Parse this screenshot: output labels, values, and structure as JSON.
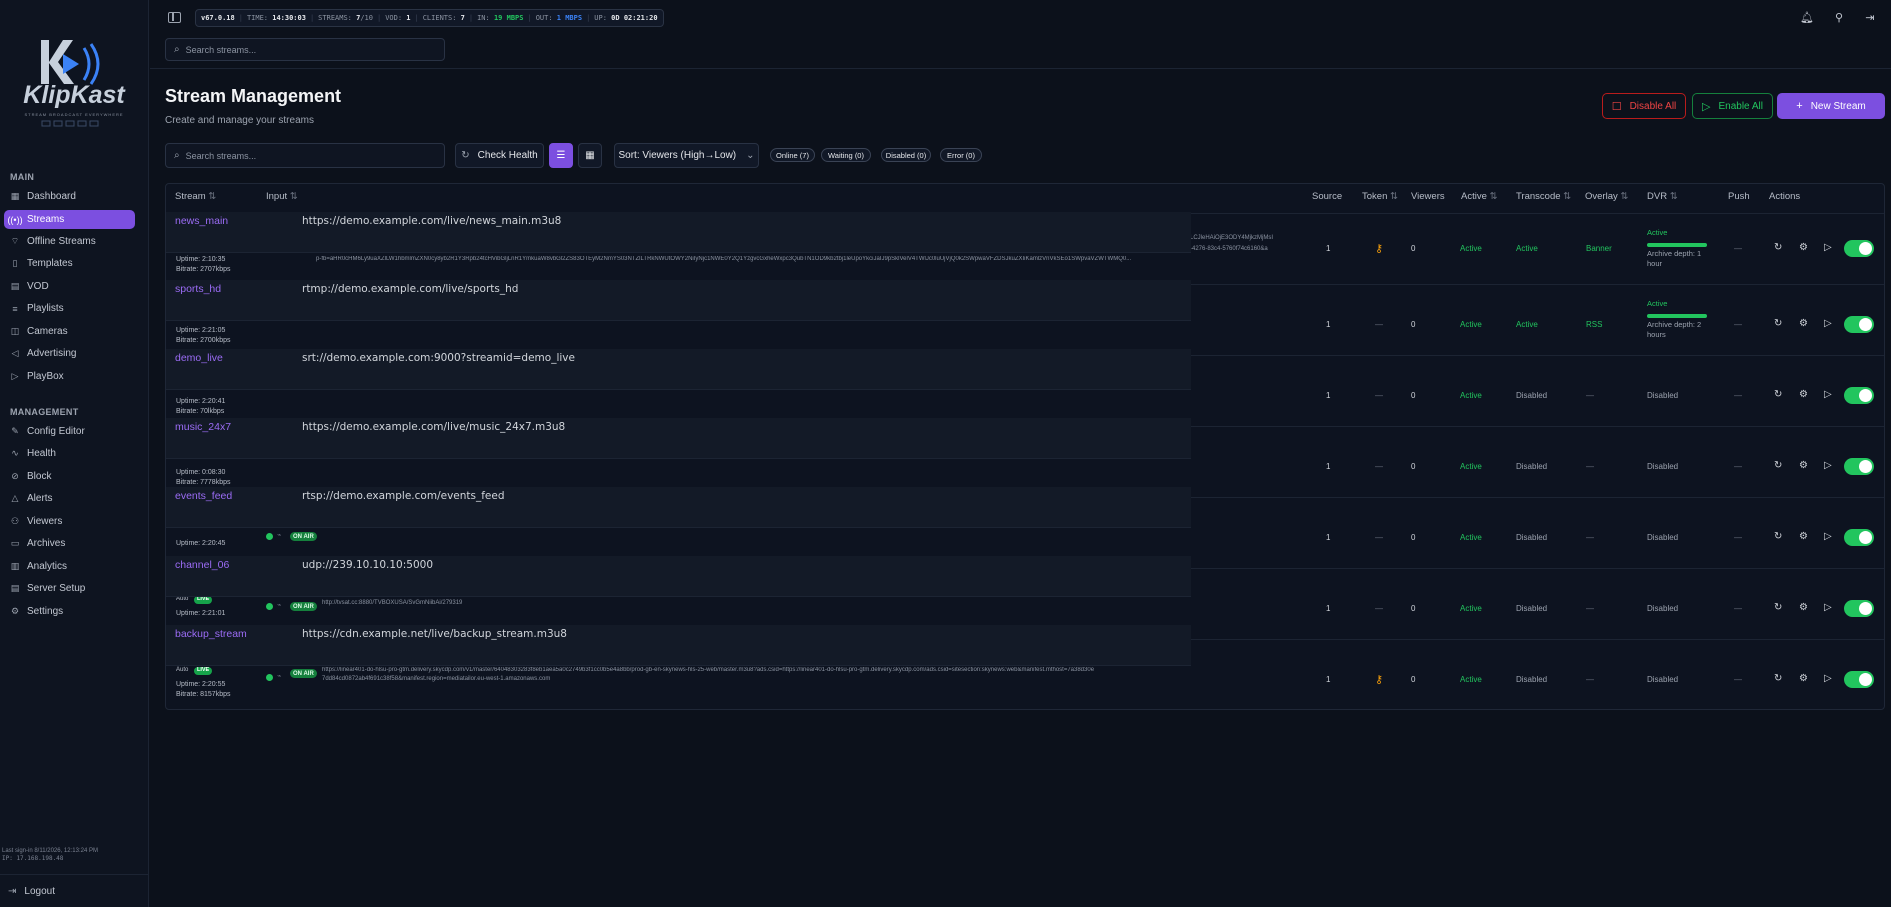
{
  "topbar": {
    "version": "v67.0.18",
    "time_label": "TIME:",
    "time": "14:30:03",
    "streams_label": "STREAMS:",
    "streams_val": "7",
    "streams_total": "/10",
    "vod_label": "VOD:",
    "vod": "1",
    "clients_label": "CLIENTS:",
    "clients": "7",
    "in_label": "IN:",
    "in_val": "19 MBPS",
    "out_label": "OUT:",
    "out_val": "1 MBPS",
    "up_label": "UP:",
    "up_val": "0D 02:21:20",
    "search_placeholder": "Search streams..."
  },
  "sidebar": {
    "brand": "KlipKast",
    "tagline": "STREAM BROADCAST EVERYWHERE",
    "main_label": "MAIN",
    "main_items": [
      {
        "label": "Dashboard",
        "icon": "grid-icon"
      },
      {
        "label": "Streams",
        "icon": "broadcast-icon"
      },
      {
        "label": "Offline Streams",
        "icon": "wifi-off-icon"
      },
      {
        "label": "Templates",
        "icon": "file-icon"
      },
      {
        "label": "VOD",
        "icon": "film-icon"
      },
      {
        "label": "Playlists",
        "icon": "list-icon"
      },
      {
        "label": "Cameras",
        "icon": "camera-icon"
      },
      {
        "label": "Advertising",
        "icon": "megaphone-icon"
      },
      {
        "label": "PlayBox",
        "icon": "box-icon"
      }
    ],
    "management_label": "MANAGEMENT",
    "management_items": [
      {
        "label": "Config Editor",
        "icon": "edit-icon"
      },
      {
        "label": "Health",
        "icon": "activity-icon"
      },
      {
        "label": "Block",
        "icon": "ban-icon"
      },
      {
        "label": "Alerts",
        "icon": "bell-icon"
      },
      {
        "label": "Viewers",
        "icon": "users-icon"
      },
      {
        "label": "Archives",
        "icon": "archive-icon"
      },
      {
        "label": "Analytics",
        "icon": "chart-icon"
      },
      {
        "label": "Server Setup",
        "icon": "server-icon"
      },
      {
        "label": "Settings",
        "icon": "gear-icon"
      }
    ],
    "last_signin": "Last sign-in 8/11/2026, 12:13:24 PM",
    "ip": "IP: 17.168.198.48",
    "logout": "Logout"
  },
  "page": {
    "title": "Stream Management",
    "subtitle": "Create and manage your streams",
    "disable_all": "Disable All",
    "enable_all": "Enable All",
    "new_stream": "New Stream",
    "search_placeholder": "Search streams...",
    "check_health": "Check Health",
    "sort": "Sort: Viewers (High→Low)",
    "filters": [
      "Online (7)",
      "Waiting (0)",
      "Disabled (0)",
      "Error (0)"
    ]
  },
  "table": {
    "headers": [
      "Stream",
      "Input",
      "Source",
      "Token",
      "Viewers",
      "Active",
      "Transcode",
      "Overlay",
      "DVR",
      "Push",
      "Actions"
    ],
    "rows": [
      {
        "name": "news_main",
        "url": "https://demo.example.com/live/news_main.m3u8",
        "uptime": "Uptime: 2:10:35",
        "bitrate": "Bitrate: 2707kbps",
        "long_url_1": "LCJleHAiOjE3ODY4MjkzMjMsI",
        "long_url_2": "-4276-83c4-5760f74c6160&a",
        "long_url_3": "p-fb=aHR0cHM6Ly9uaXZlLW1hbmlmZXN0cy8yb2R1Y3Rpb24tcHVibGljLnR1YmkuaW8vbGl2ZS83OTEyM2NmYS03NTZlLTRkNWUtOWY2NiIyNjc1NWE0Y2Q1YzgvcGxheWxpc3QubTN1OD9kb2tbj1leUpoYkciJaIJ9pSklVelV4TWlJc0luUjVjQ0k2SWpwaVFZDSJkuZXIiKamlzVnVkSEo1SWpvaVZWTWMQ0...",
        "source": "1",
        "token": "key",
        "viewers": "0",
        "active": "Active",
        "transcode": "Active",
        "overlay": "Banner",
        "dvr_status": "Active",
        "dvr_depth": "Archive depth: 1 hour",
        "push": "—"
      },
      {
        "name": "sports_hd",
        "url": "rtmp://demo.example.com/live/sports_hd",
        "uptime": "Uptime: 2:21:05",
        "bitrate": "Bitrate: 2700kbps",
        "source": "1",
        "token": "—",
        "viewers": "0",
        "active": "Active",
        "transcode": "Active",
        "overlay": "RSS",
        "dvr_status": "Active",
        "dvr_depth": "Archive depth: 2 hours",
        "push": "—"
      },
      {
        "name": "demo_live",
        "url": "srt://demo.example.com:9000?streamid=demo_live",
        "uptime": "Uptime: 2:20:41",
        "bitrate": "Bitrate: 70lkbps",
        "source": "1",
        "token": "—",
        "viewers": "0",
        "active": "Active",
        "transcode": "Disabled",
        "overlay": "—",
        "dvr_status": "Disabled",
        "push": "—"
      },
      {
        "name": "music_24x7",
        "url": "https://demo.example.com/live/music_24x7.m3u8",
        "uptime": "Uptime: 0:08:30",
        "bitrate": "Bitrate: 7778kbps",
        "source": "1",
        "token": "—",
        "viewers": "0",
        "active": "Active",
        "transcode": "Disabled",
        "overlay": "—",
        "dvr_status": "Disabled",
        "push": "—"
      },
      {
        "name": "events_feed",
        "url": "rtsp://demo.example.com/events_feed",
        "uptime": "Uptime: 2:20:45",
        "bitrate": "",
        "source": "1",
        "token": "—",
        "viewers": "0",
        "active": "Active",
        "transcode": "Disabled",
        "overlay": "—",
        "dvr_status": "Disabled",
        "push": "—"
      },
      {
        "name": "channel_06",
        "url": "udp://239.10.10.10:5000",
        "uptime": "Uptime: 2:21:01",
        "bitrate": "",
        "small_url": "http://tvsat.cc:8880/TVBOXUSA/SvGmNiibAi/279319",
        "source": "1",
        "token": "—",
        "viewers": "0",
        "active": "Active",
        "transcode": "Disabled",
        "overlay": "—",
        "dvr_status": "Disabled",
        "push": "—"
      },
      {
        "name": "backup_stream",
        "url": "https://cdn.example.net/live/backup_stream.m3u8",
        "uptime": "Uptime: 2:20:55",
        "bitrate": "Bitrate: 8157kbps",
        "small_url": "https://linear401-do-hlsu-pro-gtm.delivery.skycdp.com/v1/master/64048303283f8eb1aea5a0c2749b3f1cc0b5e4a8bb/prod-gb-en-skynews-hls-25-web/master.m3u8?ads.csid=https://linear401-do-hlsu-pro-gtm.delivery.skycdp.com/ads.csid=sitesection:skynews:web&manifest.mthost=7a38d30e",
        "small_url_2": "7dd84cd0872ab4f691c38f58&manifest.region=mediatailor.eu-west-1.amazonaws.com",
        "source": "1",
        "token": "key",
        "viewers": "0",
        "active": "Active",
        "transcode": "Disabled",
        "overlay": "—",
        "dvr_status": "Disabled",
        "push": "—"
      }
    ],
    "on_air": "ON AIR",
    "auto": "Auto",
    "live_badge": "LIVE"
  }
}
